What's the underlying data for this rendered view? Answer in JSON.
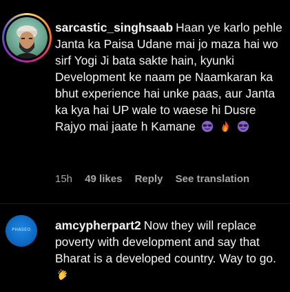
{
  "comments": [
    {
      "username": "sarcastic_singhsaab",
      "text": "Haan ye karlo pehle Janta ka Paisa Udane mai jo maza hai wo sirf Yogi Ji bata sakte hain, kyunki Development ke naam pe Naamkaran ka bhut experience hai unke paas, aur Janta ka kya hai UP wale to waese hi Dusre Rajyo mai jaate h Kamane",
      "emojis": [
        "smiling-face-with-sunglasses-emoji",
        "fire-emoji",
        "smiling-face-with-sunglasses-emoji"
      ],
      "time": "15h",
      "likes": "49 likes",
      "reply_label": "Reply",
      "translation_label": "See translation"
    },
    {
      "username": "amcypherpart2",
      "text": "Now they will replace poverty with development and say that Bharat is a developed country. Way to go.",
      "emojis": [
        "clapping-hands-emoji"
      ],
      "avatar_text": "PHASEO"
    }
  ]
}
